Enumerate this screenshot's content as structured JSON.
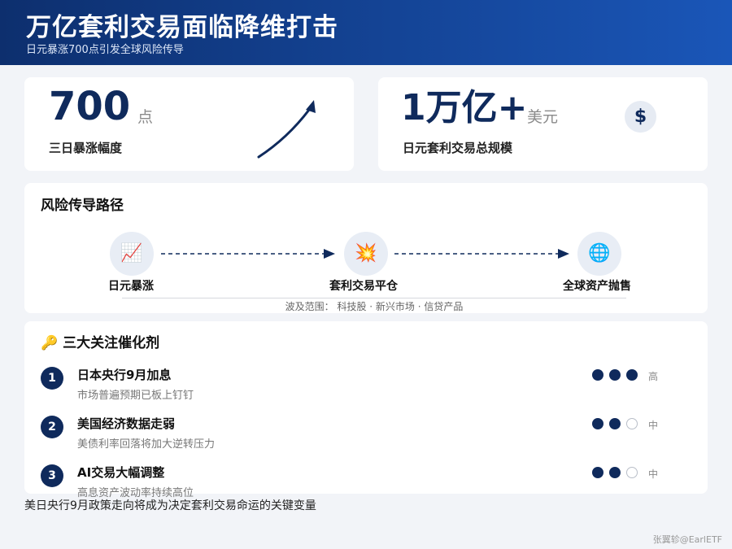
{
  "header": {
    "title": "万亿套利交易面临降维打击",
    "subtitle": "日元暴涨700点引发全球风险传导"
  },
  "stats": [
    {
      "value": "700",
      "unit": "点",
      "label": "三日暴涨幅度",
      "icon": "trend-up-arrow-icon"
    },
    {
      "value": "1万亿+",
      "unit": "美元",
      "label": "日元套利交易总规模",
      "icon": "dollar-icon",
      "icon_glyph": "$"
    }
  ],
  "flow": {
    "title": "风险传导路径",
    "nodes": [
      {
        "label": "日元暴涨",
        "icon": "chart-increasing-icon",
        "glyph": "📈"
      },
      {
        "label": "套利交易平仓",
        "icon": "explosion-icon",
        "glyph": "💥"
      },
      {
        "label": "全球资产抛售",
        "icon": "globe-icon",
        "glyph": "🌐"
      }
    ],
    "scope": "波及范围：  科技股 · 新兴市场 · 信贷产品"
  },
  "catalysts": {
    "title": "三大关注催化剂",
    "title_icon": "key-icon",
    "title_glyph": "🔑",
    "items": [
      {
        "num": "1",
        "title": "日本央行9月加息",
        "desc": "市场普遍预期已板上钉钉",
        "level": 3,
        "level_label": "高"
      },
      {
        "num": "2",
        "title": "美国经济数据走弱",
        "desc": "美债利率回落将加大逆转压力",
        "level": 2,
        "level_label": "中"
      },
      {
        "num": "3",
        "title": "AI交易大幅调整",
        "desc": "高息资产波动率持续高位",
        "level": 2,
        "level_label": "中"
      }
    ]
  },
  "conclusion": "美日央行9月政策走向将成为决定套利交易命运的关键变量",
  "credit": "张翼轸@EarlETF",
  "colors": {
    "navy": "#0f2a5c",
    "header_start": "#0d2f6e",
    "header_end": "#1a56b8"
  }
}
